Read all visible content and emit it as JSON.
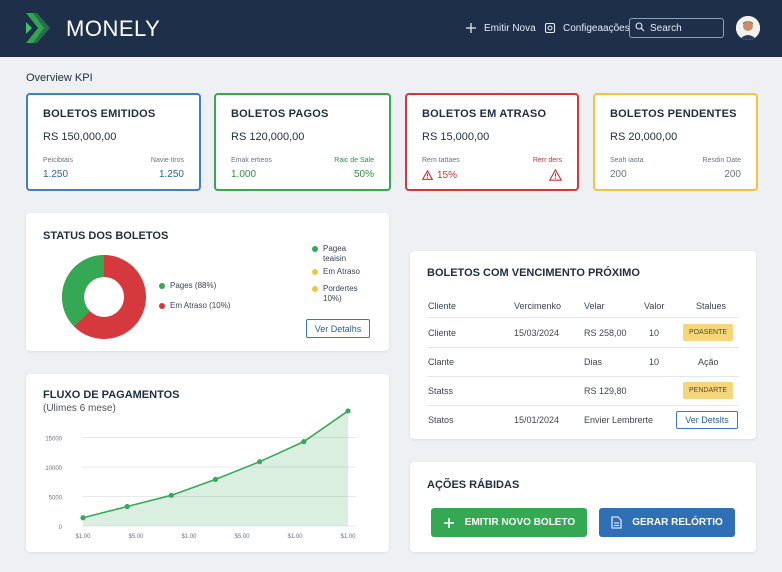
{
  "header": {
    "brand": "MONELY",
    "emitir_label": "Emitir Nova",
    "config_label": "Configeaações",
    "search_placeholder": "Search"
  },
  "overview": {
    "title": "Overview KPI"
  },
  "kpis": [
    {
      "title": "BOLETOS EMITIDOS",
      "value": "RS 150,000,00",
      "left_label": "Peicibtais",
      "right_label": "Navie tiros",
      "left_value": "1.250",
      "right_value": "1.250",
      "border": "#3b82c4"
    },
    {
      "title": "BOLETOS PAGOS",
      "value": "RS 120,000,00",
      "left_label": "Emak ertieos",
      "right_label": "Raic de Sale",
      "left_value": "1.000",
      "right_value": "50%",
      "border": "#34a853"
    },
    {
      "title": "BOLETOS EM ATRASO",
      "value": "RS 15,000,00",
      "left_label": "Rem tattaes",
      "right_label": "Rerr ders",
      "left_value": "15%",
      "right_value": "",
      "border": "#d0393e"
    },
    {
      "title": "BOLETOS PENDENTES",
      "value": "RS 20,000,00",
      "left_label": "Seah iaota",
      "right_label": "Resdin Date",
      "left_value": "200",
      "right_value": "200",
      "border": "#efc63f"
    }
  ],
  "status": {
    "title": "STATUS DOS BOLETOS",
    "pie_legend": [
      {
        "label": "Pages (88%)",
        "color": "#34a853"
      },
      {
        "label": "Em Atraso (10%)",
        "color": "#d0393e"
      }
    ],
    "side_legend": [
      {
        "label": "Pagea\nteaisin",
        "color": "#34a853"
      },
      {
        "label": "Em Atraso",
        "color": "#efc63f"
      },
      {
        "label": "Pordertes\n10%)",
        "color": "#efc63f"
      }
    ],
    "details_button": "Ver Detalhs"
  },
  "chart_data": {
    "type": "area",
    "title": "FLUXO DE PAGAMENTOS",
    "subtitle": "(Ulimes 6 mese)",
    "y_ticks": [
      "15000",
      "10000",
      "5000",
      "0"
    ],
    "x_ticks": [
      "$1.00",
      "$5.00",
      "$1.00",
      "$5.00",
      "$1.00",
      "$1.00"
    ],
    "ylim": [
      0,
      20000
    ],
    "values": [
      1400,
      3300,
      5200,
      7900,
      10900,
      14300,
      19500
    ],
    "color": "#39a85a"
  },
  "upcoming": {
    "title": "BOLETOS COM VENCIMENTO PRÓXIMO",
    "headers": [
      "Cliente",
      "Vercimenko",
      "Velar",
      "Valor",
      "Stalues"
    ],
    "rows": [
      {
        "c1": "Cliente",
        "c2": "15/03/2024",
        "c3": "RS 258,00",
        "c4": "10",
        "status": "POASENTE",
        "type": "pill"
      },
      {
        "c1": "Clante",
        "c2": "",
        "c3": "Dias",
        "c4": "10",
        "status": "Ação",
        "type": "text"
      },
      {
        "c1": "Statss",
        "c2": "",
        "c3": "RS 129,80",
        "c4": "",
        "status": "PENDARTE",
        "type": "pill"
      },
      {
        "c1": "Statos",
        "c2": "15/01/2024",
        "c3": "Envier Lembrerte",
        "c4": "",
        "status": "Ver Detslts",
        "type": "button"
      }
    ]
  },
  "quick": {
    "title": "AÇÕES RÁBIDAS",
    "emit_button": "EMITIR NOVO BOLETO",
    "report_button": "GERAR RELÓRTIO",
    "emit_color": "#34a853",
    "report_color": "#2f6fb5"
  }
}
